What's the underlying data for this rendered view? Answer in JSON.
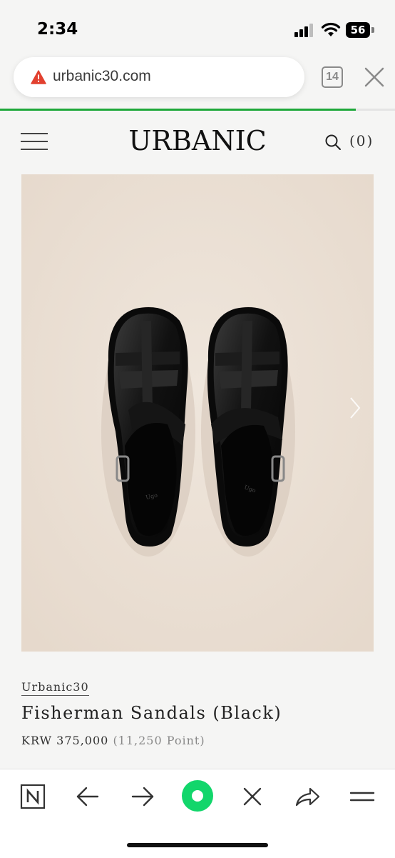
{
  "status_bar": {
    "time": "2:34",
    "battery": "56"
  },
  "browser": {
    "url": "urbanic30.com",
    "tab_count": "14",
    "load_progress": 0.9,
    "accent_color": "#1ea83a",
    "warning_color": "#e2402f"
  },
  "site": {
    "logo": "URBANIC",
    "cart_count": "(0)"
  },
  "product": {
    "brand": "Urbanic30",
    "name": "Fisherman Sandals (Black)",
    "price": "KRW 375,000",
    "points": "(11,250 Point)",
    "image_background": "#eadfd4"
  },
  "toolbar": {
    "icons": [
      "naver-n-icon",
      "back-arrow-icon",
      "forward-arrow-icon",
      "green-dot-icon",
      "close-icon",
      "share-icon",
      "menu-icon"
    ]
  }
}
